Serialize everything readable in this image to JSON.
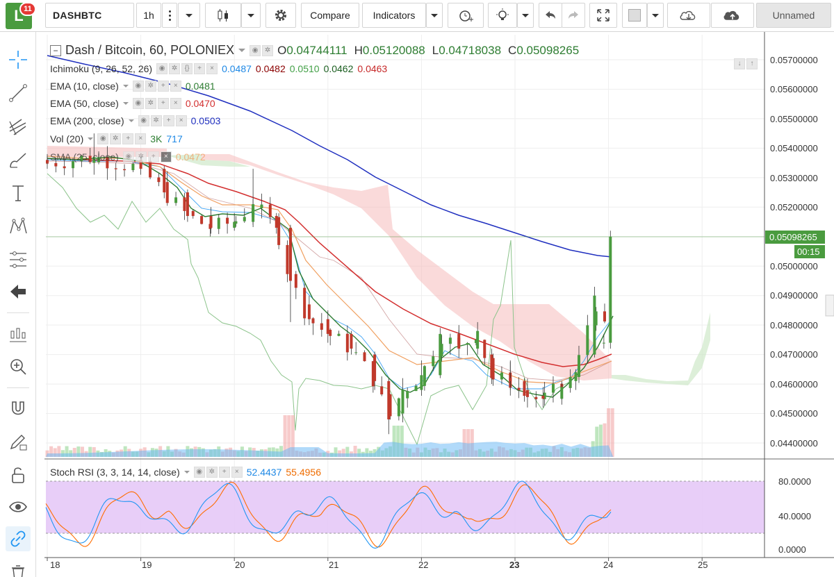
{
  "app": {
    "logo_letter": "L",
    "notifications": "11"
  },
  "toolbar": {
    "symbol": "DASHBTC",
    "interval": "1h",
    "compare_label": "Compare",
    "indicators_label": "Indicators",
    "layout_name": "Unnamed"
  },
  "legend": {
    "main_title": "Dash / Bitcoin, 60, POLONIEX",
    "open_label": "O",
    "open": "0.04744111",
    "high_label": "H",
    "high": "0.05120088",
    "low_label": "L",
    "low": "0.04718038",
    "close_label": "C",
    "close": "0.05098265",
    "ichimoku": {
      "label": "Ichimoku (9, 26, 52, 26)",
      "v1": "0.0487",
      "v2": "0.0482",
      "v3": "0.0510",
      "v4": "0.0462",
      "v5": "0.0463"
    },
    "ema10": {
      "label": "EMA (10, close)",
      "value": "0.0481"
    },
    "ema50": {
      "label": "EMA (50, close)",
      "value": "0.0470"
    },
    "ema200": {
      "label": "EMA (200, close)",
      "value": "0.0503"
    },
    "vol": {
      "label": "Vol (20)",
      "v1": "3K",
      "v2": "717"
    },
    "sma": {
      "label": "SMA (25, close)",
      "value": "0.0472"
    },
    "stoch": {
      "label": "Stoch RSI (3, 3, 14, 14, close)",
      "k": "52.4437",
      "d": "55.4956"
    }
  },
  "price_axis": {
    "labels": [
      "0.05700000",
      "0.05600000",
      "0.05500000",
      "0.05400000",
      "0.05300000",
      "0.05200000",
      "0.05000000",
      "0.04900000",
      "0.04800000",
      "0.04700000",
      "0.04600000",
      "0.04500000",
      "0.04400000"
    ],
    "last_price": "0.05098265",
    "countdown": "00:15"
  },
  "stoch_axis": {
    "labels": [
      "80.0000",
      "40.0000",
      "0.0000"
    ]
  },
  "time_axis": {
    "labels": [
      "18",
      "19",
      "20",
      "21",
      "22",
      "23",
      "24",
      "25"
    ]
  },
  "colors": {
    "up": "#4a9b3f",
    "down": "#c0392b",
    "ema10": "#2e7d32",
    "ema50": "#d32f2f",
    "ema200": "#1f2fbf",
    "sma": "#f4a460",
    "ichimoku_base": "#1e88e5",
    "stoch_k": "#2196f3",
    "stoch_d": "#ff6d00",
    "stoch_band": "#e4c6f7"
  },
  "chart_data": {
    "type": "candlestick",
    "ylim": [
      0.0437,
      0.0574
    ],
    "ohlc_approx": [
      {
        "x": 18.0,
        "o": 0.0536,
        "h": 0.0538,
        "l": 0.0533,
        "c": 0.0535
      },
      {
        "x": 18.5,
        "o": 0.0535,
        "h": 0.0545,
        "l": 0.0531,
        "c": 0.0537
      },
      {
        "x": 19.0,
        "o": 0.0536,
        "h": 0.0537,
        "l": 0.0531,
        "c": 0.0533
      },
      {
        "x": 19.25,
        "o": 0.0533,
        "h": 0.0534,
        "l": 0.0523,
        "c": 0.0525
      },
      {
        "x": 19.5,
        "o": 0.0525,
        "h": 0.0526,
        "l": 0.0515,
        "c": 0.0517
      },
      {
        "x": 19.75,
        "o": 0.0517,
        "h": 0.052,
        "l": 0.0511,
        "c": 0.0513
      },
      {
        "x": 20.0,
        "o": 0.0513,
        "h": 0.0518,
        "l": 0.0512,
        "c": 0.0515
      },
      {
        "x": 20.2,
        "o": 0.0515,
        "h": 0.0533,
        "l": 0.0514,
        "c": 0.0521
      },
      {
        "x": 20.45,
        "o": 0.0517,
        "h": 0.0518,
        "l": 0.0511,
        "c": 0.0513
      },
      {
        "x": 20.6,
        "o": 0.0513,
        "h": 0.0514,
        "l": 0.0481,
        "c": 0.0495
      },
      {
        "x": 20.8,
        "o": 0.0487,
        "h": 0.049,
        "l": 0.048,
        "c": 0.0482
      },
      {
        "x": 21.0,
        "o": 0.0482,
        "h": 0.0485,
        "l": 0.0474,
        "c": 0.0477
      },
      {
        "x": 21.25,
        "o": 0.0477,
        "h": 0.0478,
        "l": 0.047,
        "c": 0.0472
      },
      {
        "x": 21.5,
        "o": 0.047,
        "h": 0.0471,
        "l": 0.0458,
        "c": 0.0461
      },
      {
        "x": 21.65,
        "o": 0.0461,
        "h": 0.0462,
        "l": 0.0443,
        "c": 0.0448
      },
      {
        "x": 21.8,
        "o": 0.045,
        "h": 0.0462,
        "l": 0.0447,
        "c": 0.0458
      },
      {
        "x": 22.0,
        "o": 0.0458,
        "h": 0.0468,
        "l": 0.0456,
        "c": 0.0463
      },
      {
        "x": 22.2,
        "o": 0.0463,
        "h": 0.0479,
        "l": 0.0462,
        "c": 0.0477
      },
      {
        "x": 22.4,
        "o": 0.0477,
        "h": 0.048,
        "l": 0.0469,
        "c": 0.0472
      },
      {
        "x": 22.6,
        "o": 0.0472,
        "h": 0.0481,
        "l": 0.047,
        "c": 0.0478
      },
      {
        "x": 22.75,
        "o": 0.047,
        "h": 0.0472,
        "l": 0.046,
        "c": 0.0462
      },
      {
        "x": 22.95,
        "o": 0.0462,
        "h": 0.0468,
        "l": 0.0458,
        "c": 0.0461
      },
      {
        "x": 23.1,
        "o": 0.0461,
        "h": 0.0462,
        "l": 0.0454,
        "c": 0.0456
      },
      {
        "x": 23.3,
        "o": 0.0456,
        "h": 0.0459,
        "l": 0.0452,
        "c": 0.0455
      },
      {
        "x": 23.5,
        "o": 0.0455,
        "h": 0.0461,
        "l": 0.0453,
        "c": 0.0459
      },
      {
        "x": 23.65,
        "o": 0.0461,
        "h": 0.0465,
        "l": 0.0458,
        "c": 0.0464
      },
      {
        "x": 23.85,
        "o": 0.047,
        "h": 0.0493,
        "l": 0.0469,
        "c": 0.049
      },
      {
        "x": 23.95,
        "o": 0.0474,
        "h": 0.0477,
        "l": 0.0472,
        "c": 0.0474
      },
      {
        "x": 24.02,
        "o": 0.0474,
        "h": 0.0512,
        "l": 0.0472,
        "c": 0.051
      }
    ],
    "ema200_approx": [
      [
        18,
        0.0569
      ],
      [
        19,
        0.056
      ],
      [
        20,
        0.0552
      ],
      [
        21,
        0.054
      ],
      [
        22,
        0.0522
      ],
      [
        23,
        0.051
      ],
      [
        24,
        0.0503
      ]
    ],
    "ema50_approx": [
      [
        18,
        0.0536
      ],
      [
        19,
        0.0533
      ],
      [
        20,
        0.0526
      ],
      [
        20.6,
        0.0517
      ],
      [
        21,
        0.05
      ],
      [
        22,
        0.0478
      ],
      [
        23,
        0.0469
      ],
      [
        23.5,
        0.0466
      ],
      [
        24,
        0.047
      ]
    ],
    "stoch_band": [
      20,
      80
    ]
  }
}
